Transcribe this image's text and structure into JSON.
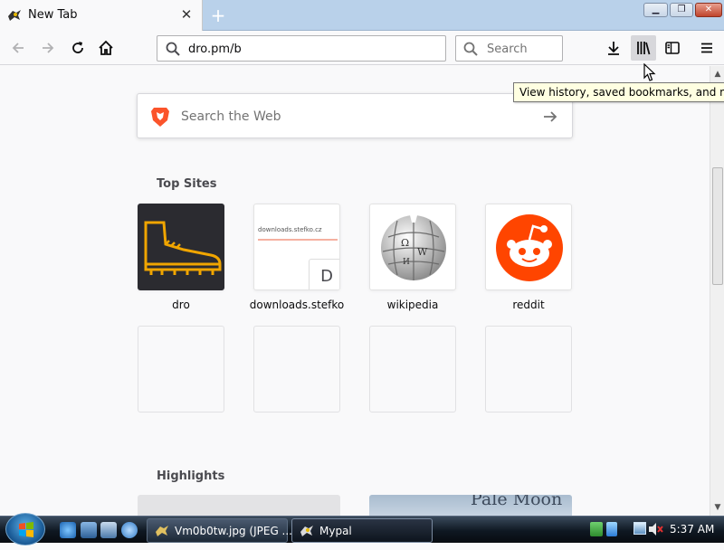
{
  "tab": {
    "title": "New Tab"
  },
  "navbar": {
    "url": "dro.pm/b",
    "search_placeholder": "Search"
  },
  "tooltip": "View history, saved bookmarks, and more",
  "newtab": {
    "websearch_placeholder": "Search the Web",
    "top_sites_title": "Top Sites",
    "highlights_title": "Highlights",
    "sites": [
      {
        "label": "dro"
      },
      {
        "label": "downloads.stefko",
        "thumb_text": "downloads.stefko.cz",
        "badge": "D"
      },
      {
        "label": "wikipedia"
      },
      {
        "label": "reddit"
      }
    ],
    "highlight_text": "Pale Moon"
  },
  "taskbar": {
    "tasks": [
      {
        "label": "Vm0b0tw.jpg (JPEG ..."
      },
      {
        "label": "Mypal"
      }
    ],
    "clock": "5:37 AM"
  },
  "colors": {
    "reddit": "#ff4500",
    "dro_tile": "#2b2b30",
    "dro_boot": "#f0a500",
    "brave": "#fb542b"
  }
}
